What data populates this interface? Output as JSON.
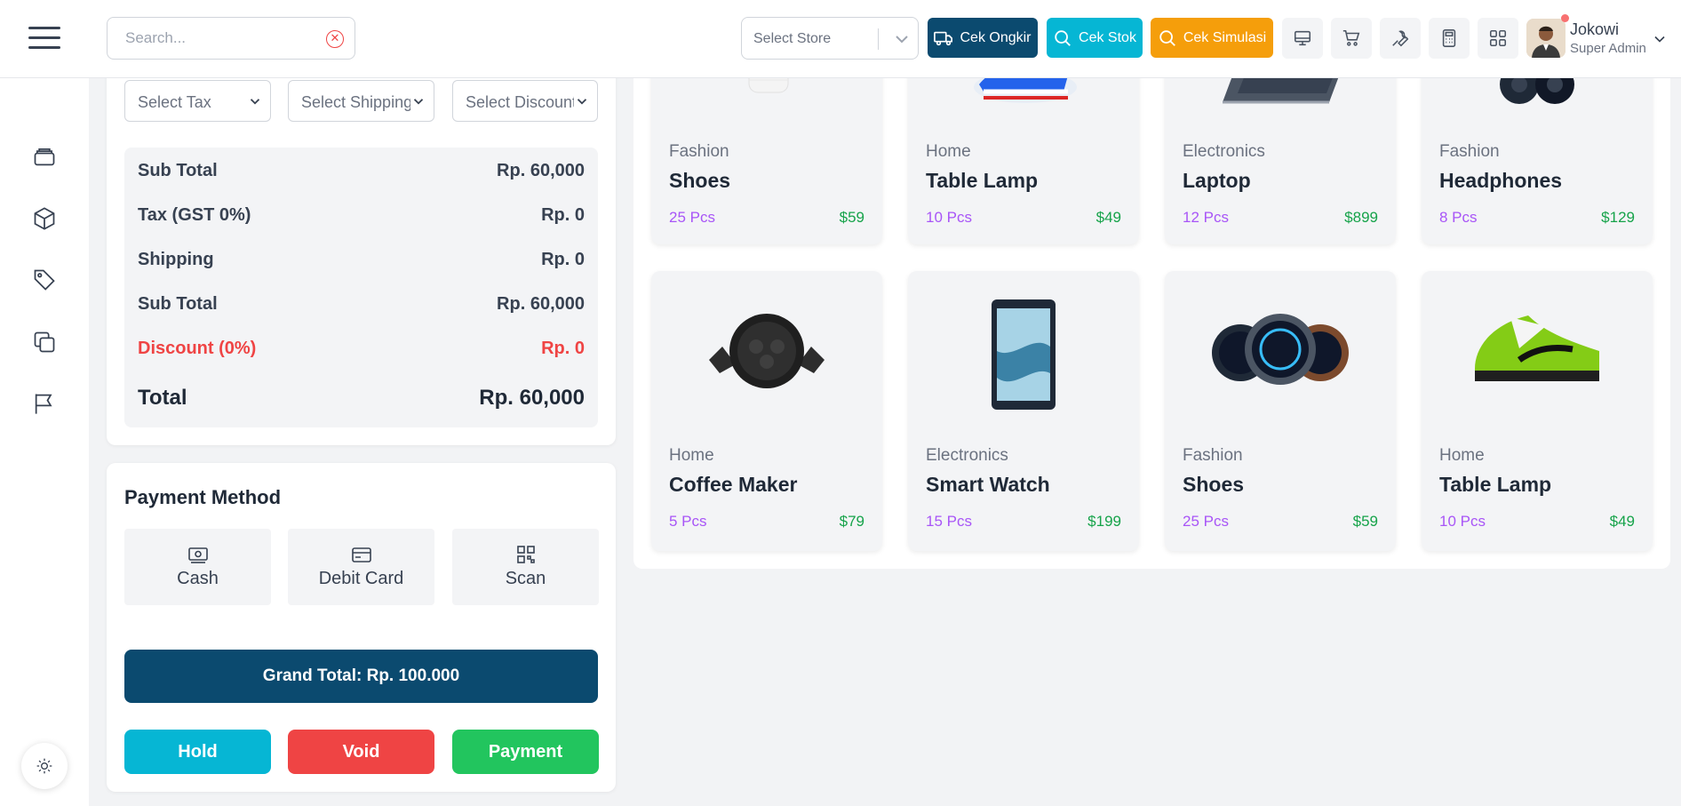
{
  "header": {
    "search_placeholder": "Search...",
    "store_select": "Select Store",
    "buttons": {
      "ongkir": "Cek Ongkir",
      "stok": "Cek Stok",
      "simulasi": "Cek Simulasi"
    },
    "user": {
      "name": "Jokowi",
      "role": "Super Admin"
    }
  },
  "filters": {
    "tax": "Select Tax",
    "shipping": "Select Shipping",
    "discount": "Select Discount"
  },
  "totals": {
    "rows": [
      {
        "label": "Sub Total",
        "value": "Rp. 60,000"
      },
      {
        "label": "Tax (GST 0%)",
        "value": "Rp. 0"
      },
      {
        "label": "Shipping",
        "value": "Rp. 0"
      },
      {
        "label": "Sub Total",
        "value": "Rp. 60,000"
      },
      {
        "label": "Discount (0%)",
        "value": "Rp. 0"
      }
    ],
    "total_label": "Total",
    "total_value": "Rp. 60,000"
  },
  "payment": {
    "title": "Payment Method",
    "methods": [
      "Cash",
      "Debit Card",
      "Scan"
    ],
    "grand_total": "Grand Total: Rp. 100.000",
    "actions": {
      "hold": "Hold",
      "void": "Void",
      "pay": "Payment"
    }
  },
  "products": [
    {
      "category": "Fashion",
      "name": "Shoes",
      "qty": "25 Pcs",
      "price": "$59"
    },
    {
      "category": "Home",
      "name": "Table Lamp",
      "qty": "10 Pcs",
      "price": "$49"
    },
    {
      "category": "Electronics",
      "name": "Laptop",
      "qty": "12 Pcs",
      "price": "$899"
    },
    {
      "category": "Fashion",
      "name": "Headphones",
      "qty": "8 Pcs",
      "price": "$129"
    },
    {
      "category": "Home",
      "name": "Coffee Maker",
      "qty": "5 Pcs",
      "price": "$79"
    },
    {
      "category": "Electronics",
      "name": "Smart Watch",
      "qty": "15 Pcs",
      "price": "$199"
    },
    {
      "category": "Fashion",
      "name": "Shoes",
      "qty": "25 Pcs",
      "price": "$59"
    },
    {
      "category": "Home",
      "name": "Table Lamp",
      "qty": "10 Pcs",
      "price": "$49"
    }
  ],
  "colors": {
    "primary": "#0b4a6f",
    "cyan": "#06b6d4",
    "orange": "#f59e0b",
    "red": "#ef4444",
    "green": "#22c55e",
    "purple": "#a855f7"
  }
}
